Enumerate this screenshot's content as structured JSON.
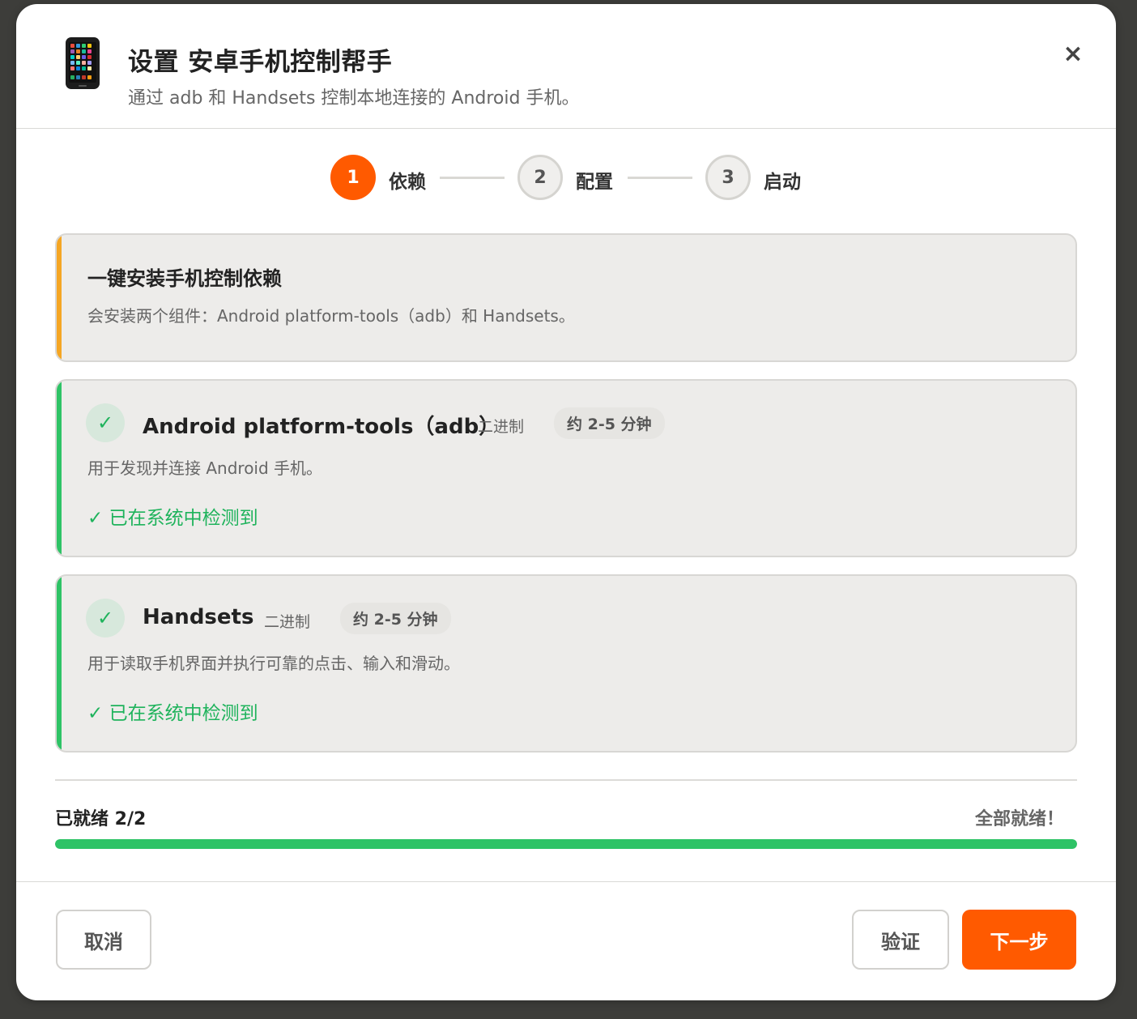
{
  "dialog": {
    "title": "设置 安卓手机控制帮手",
    "subtitle": "通过 adb 和 Handsets 控制本地连接的 Android 手机。",
    "icon": "mobile-phone-icon",
    "close_label": "×"
  },
  "steps": [
    {
      "number": "1",
      "label": "依赖",
      "state": "active"
    },
    {
      "number": "2",
      "label": "配置",
      "state": "inactive"
    },
    {
      "number": "3",
      "label": "启动",
      "state": "inactive"
    }
  ],
  "intro": {
    "title": "一键安装手机控制依赖",
    "description": "会安装两个组件：Android platform-tools（adb）和 Handsets。"
  },
  "components": [
    {
      "name": "Android platform-tools（adb）",
      "type": "二进制",
      "time": "约 2-5 分钟",
      "description": "用于发现并连接 Android 手机。",
      "status": "✓ 已在系统中检测到",
      "check": "✓"
    },
    {
      "name": "Handsets",
      "type": "二进制",
      "time": "约 2-5 分钟",
      "description": "用于读取手机界面并执行可靠的点击、输入和滑动。",
      "status": "✓ 已在系统中检测到",
      "check": "✓"
    }
  ],
  "progress": {
    "label": "已就绪 2/2",
    "message": "全部就绪！",
    "fraction": 1.0
  },
  "footer": {
    "cancel_label": "取消",
    "verify_label": "验证",
    "next_label": "下一步"
  },
  "colors": {
    "accent": "#ff5a00",
    "success": "#2ec366",
    "warning": "#f5a623"
  }
}
